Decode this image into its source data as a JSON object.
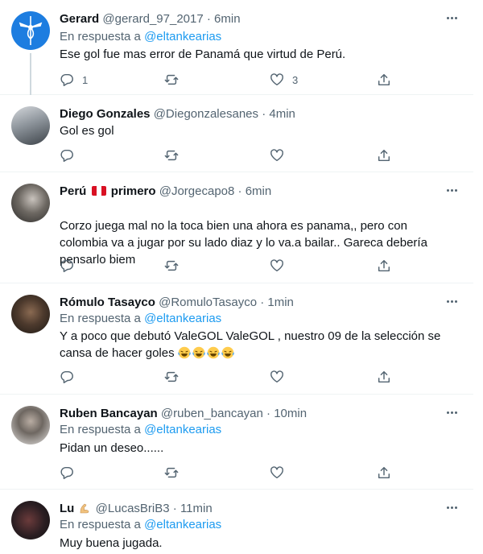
{
  "reply_to_label": "En respuesta a",
  "tweets": [
    {
      "name": "Gerard",
      "handle": "@gerard_97_2017",
      "separator": "·",
      "time": "6min",
      "reply_to": "@eltankearias",
      "text": "Ese gol fue mas error de Panamá que virtud de Perú.",
      "replies": "1",
      "retweets": "",
      "likes": "3"
    },
    {
      "name": "Diego Gonzales",
      "handle": "@Diegonzalesanes",
      "separator": "·",
      "time": "4min",
      "text": "Gol es gol",
      "replies": "",
      "retweets": "",
      "likes": ""
    },
    {
      "name_a": "Perú",
      "name_b": "primero",
      "flag": "peru-flag-emoji",
      "handle": "@Jorgecapo8",
      "separator": "·",
      "time": "6min",
      "text": "Corzo juega mal no la toca bien una ahora es panama,, pero con colombia va a jugar por su lado diaz y lo va.a bailar.. Gareca debería pensarlo biem",
      "replies": "",
      "retweets": "",
      "likes": ""
    },
    {
      "name": "Rómulo Tasayco",
      "handle": "@RomuloTasayco",
      "separator": "·",
      "time": "1min",
      "reply_to": "@eltankearias",
      "text": "Y a poco que debutó ValeGOL ValeGOL , nuestro 09 de la selección se cansa de hacer goles",
      "emoji": "laughing-tears-emoji",
      "emoji_count": 4,
      "replies": "",
      "retweets": "",
      "likes": ""
    },
    {
      "name": "Ruben Bancayan",
      "handle": "@ruben_bancayan",
      "separator": "·",
      "time": "10min",
      "reply_to": "@eltankearias",
      "text": "Pidan un deseo......",
      "replies": "",
      "retweets": "",
      "likes": ""
    },
    {
      "name": "Lu",
      "name_emoji": "flexed-biceps-emoji",
      "handle": "@LucasBriB3",
      "separator": "·",
      "time": "11min",
      "reply_to": "@eltankearias",
      "text": "Muy buena jugada."
    }
  ],
  "colors": {
    "accent": "#1d9bf0",
    "secondary_text": "#536471",
    "divider": "#eff3f4"
  }
}
